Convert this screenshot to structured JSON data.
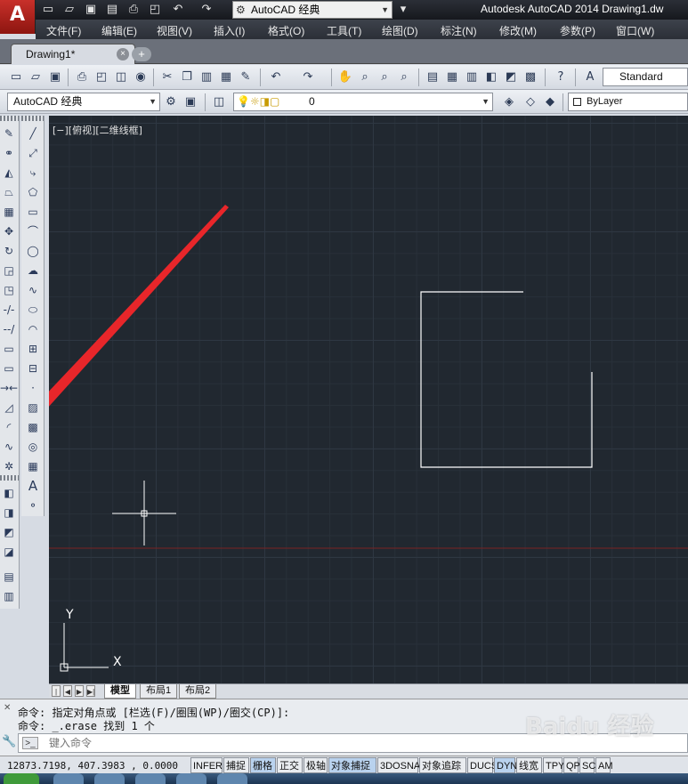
{
  "titlebar": {
    "app_logo": "A",
    "workspace": "AutoCAD 经典",
    "title": "Autodesk AutoCAD 2014    Drawing1.dw"
  },
  "menu": [
    "文件(F)",
    "编辑(E)",
    "视图(V)",
    "插入(I)",
    "格式(O)",
    "工具(T)",
    "绘图(D)",
    "标注(N)",
    "修改(M)",
    "参数(P)",
    "窗口(W)"
  ],
  "tabs": {
    "document": "Drawing1*",
    "close": "×",
    "new": "+"
  },
  "toolbar": {
    "text_style": "Standard",
    "workspace": "AutoCAD 经典",
    "layer": "0",
    "color": "ByLayer"
  },
  "canvas": {
    "view_label": "[−][俯视][二维线框]",
    "ucs_x": "X",
    "ucs_y": "Y",
    "colors": {
      "background": "#212830",
      "lines": "#ffffff",
      "arrow": "#e8262a",
      "x_axis": "#7a2222"
    }
  },
  "layout_tabs": [
    "模型",
    "布局1",
    "布局2"
  ],
  "command": {
    "history": [
      "命令: 指定对角点或 [栏选(F)/圈围(WP)/圈交(CP)]:",
      "命令: _.erase 找到 1 个"
    ],
    "placeholder": "键入命令"
  },
  "status": {
    "coordinates": "12873.7198, 407.3983 , 0.0000",
    "toggles": [
      {
        "label": "INFER",
        "on": false
      },
      {
        "label": "捕捉",
        "on": false
      },
      {
        "label": "栅格",
        "on": true
      },
      {
        "label": "正交",
        "on": false
      },
      {
        "label": "极轴",
        "on": false
      },
      {
        "label": "对象捕捉",
        "on": true
      },
      {
        "label": "3DOSNAP",
        "on": false
      },
      {
        "label": "对象追踪",
        "on": false
      },
      {
        "label": "DUCS",
        "on": false
      },
      {
        "label": "DYN",
        "on": true
      },
      {
        "label": "线宽",
        "on": false
      },
      {
        "label": "TPY",
        "on": false
      },
      {
        "label": "QP",
        "on": false
      },
      {
        "label": "SC",
        "on": false
      },
      {
        "label": "AM",
        "on": false
      }
    ]
  },
  "watermark": "Baidu 经验"
}
